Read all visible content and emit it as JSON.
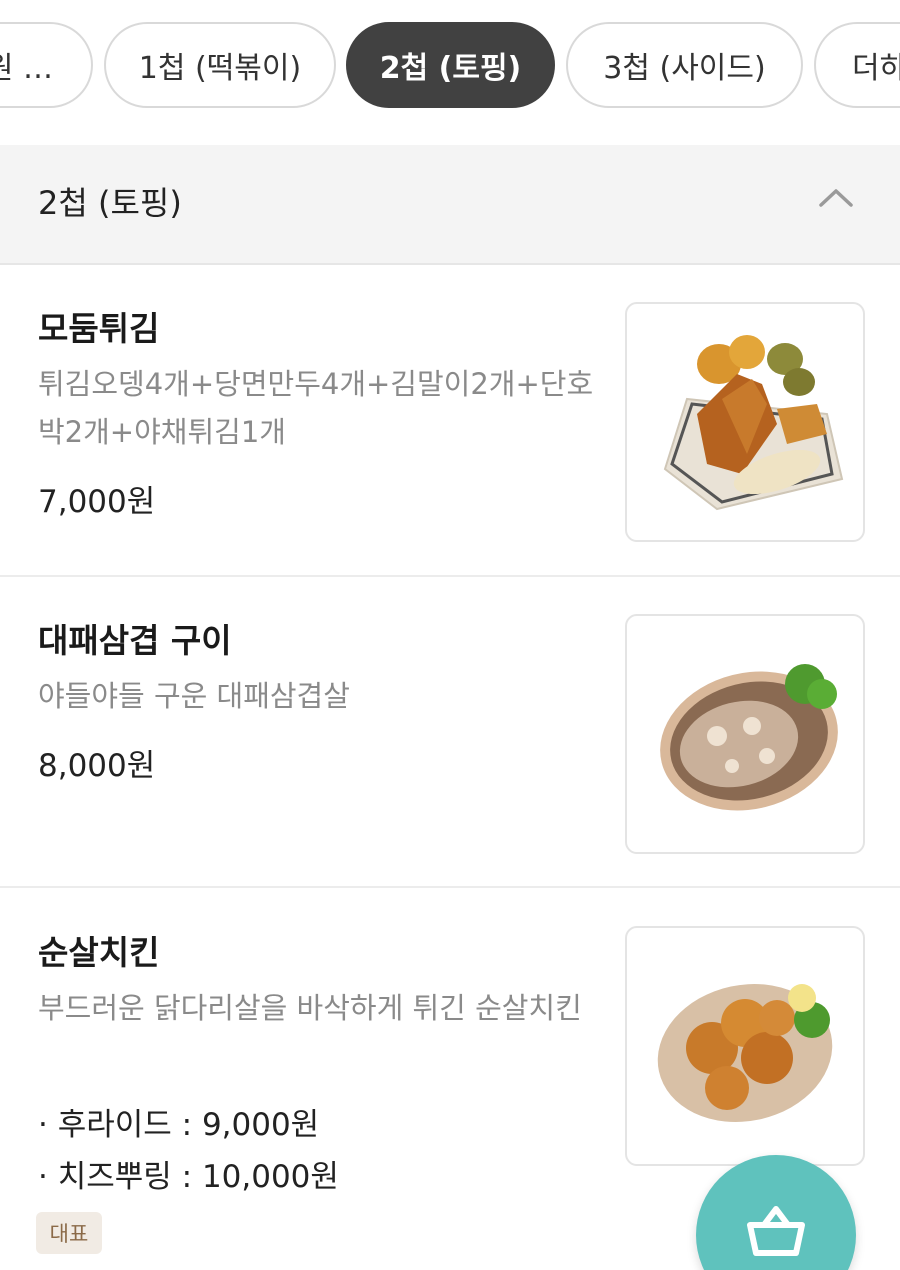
{
  "tabs": [
    {
      "label": "원 …",
      "active": false
    },
    {
      "label": "1첩 (떡볶이)",
      "active": false
    },
    {
      "label": "2첩 (토핑)",
      "active": true
    },
    {
      "label": "3첩 (사이드)",
      "active": false
    },
    {
      "label": "더하",
      "active": false
    }
  ],
  "section": {
    "title": "2첩 (토핑)",
    "collapse_icon": "chevron-up-icon"
  },
  "items": [
    {
      "name": "모둠튀김",
      "description": "튀김오뎅4개+당면만두4개+김말이2개+단호박2개+야채튀김1개",
      "price": "7,000원"
    },
    {
      "name": "대패삼겹 구이",
      "description": "야들야들 구운 대패삼겹살",
      "price": "8,000원"
    },
    {
      "name": "순살치킨",
      "description": "부드러운 닭다리살을 바삭하게 튀긴 순살치킨",
      "options": [
        "· 후라이드 : 9,000원",
        "· 치즈뿌링 : 10,000원"
      ],
      "badge": "대표"
    }
  ],
  "cart": {
    "icon": "shopping-basket-icon",
    "color": "#5fc2bd"
  },
  "colors": {
    "active_tab": "#414141",
    "section_bg": "#f4f4f4",
    "desc_text": "#8a8a8a"
  }
}
